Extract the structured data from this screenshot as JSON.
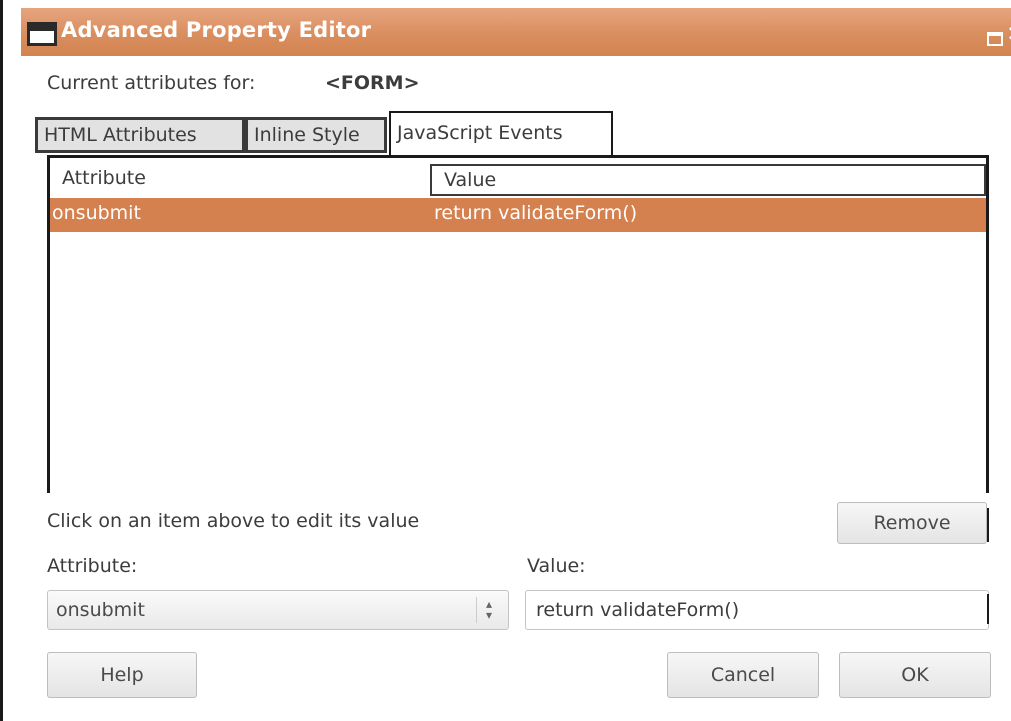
{
  "window": {
    "title": "Advanced Property Editor"
  },
  "context": {
    "label": "Current attributes for:",
    "tag": "<FORM>"
  },
  "tabs": [
    {
      "label": "HTML Attributes",
      "active": false
    },
    {
      "label": "Inline Style",
      "active": false
    },
    {
      "label": "JavaScript Events",
      "active": true
    }
  ],
  "table": {
    "columns": [
      "Attribute",
      "Value"
    ],
    "rows": [
      {
        "attribute": "onsubmit",
        "value": "return validateForm()",
        "selected": true
      }
    ]
  },
  "hint": "Click on an item above to edit its value",
  "buttons": {
    "remove": "Remove",
    "help": "Help",
    "cancel": "Cancel",
    "ok": "OK"
  },
  "editor": {
    "attribute_label": "Attribute:",
    "attribute_value": "onsubmit",
    "value_label": "Value:",
    "value_value": "return validateForm()"
  },
  "colors": {
    "titlebar": "#d98e5f",
    "selection": "#d4814f"
  },
  "icons": [
    "window-icon",
    "maximize-icon",
    "close-icon",
    "spinner-arrows-icon"
  ]
}
